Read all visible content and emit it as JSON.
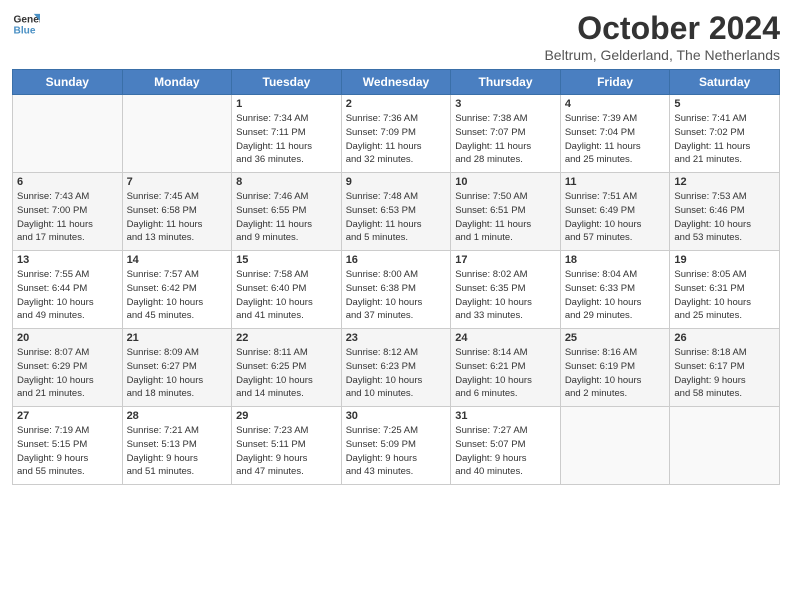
{
  "header": {
    "logo_line1": "General",
    "logo_line2": "Blue",
    "title": "October 2024",
    "location": "Beltrum, Gelderland, The Netherlands"
  },
  "days_of_week": [
    "Sunday",
    "Monday",
    "Tuesday",
    "Wednesday",
    "Thursday",
    "Friday",
    "Saturday"
  ],
  "weeks": [
    [
      {
        "day": "",
        "content": ""
      },
      {
        "day": "",
        "content": ""
      },
      {
        "day": "1",
        "content": "Sunrise: 7:34 AM\nSunset: 7:11 PM\nDaylight: 11 hours\nand 36 minutes."
      },
      {
        "day": "2",
        "content": "Sunrise: 7:36 AM\nSunset: 7:09 PM\nDaylight: 11 hours\nand 32 minutes."
      },
      {
        "day": "3",
        "content": "Sunrise: 7:38 AM\nSunset: 7:07 PM\nDaylight: 11 hours\nand 28 minutes."
      },
      {
        "day": "4",
        "content": "Sunrise: 7:39 AM\nSunset: 7:04 PM\nDaylight: 11 hours\nand 25 minutes."
      },
      {
        "day": "5",
        "content": "Sunrise: 7:41 AM\nSunset: 7:02 PM\nDaylight: 11 hours\nand 21 minutes."
      }
    ],
    [
      {
        "day": "6",
        "content": "Sunrise: 7:43 AM\nSunset: 7:00 PM\nDaylight: 11 hours\nand 17 minutes."
      },
      {
        "day": "7",
        "content": "Sunrise: 7:45 AM\nSunset: 6:58 PM\nDaylight: 11 hours\nand 13 minutes."
      },
      {
        "day": "8",
        "content": "Sunrise: 7:46 AM\nSunset: 6:55 PM\nDaylight: 11 hours\nand 9 minutes."
      },
      {
        "day": "9",
        "content": "Sunrise: 7:48 AM\nSunset: 6:53 PM\nDaylight: 11 hours\nand 5 minutes."
      },
      {
        "day": "10",
        "content": "Sunrise: 7:50 AM\nSunset: 6:51 PM\nDaylight: 11 hours\nand 1 minute."
      },
      {
        "day": "11",
        "content": "Sunrise: 7:51 AM\nSunset: 6:49 PM\nDaylight: 10 hours\nand 57 minutes."
      },
      {
        "day": "12",
        "content": "Sunrise: 7:53 AM\nSunset: 6:46 PM\nDaylight: 10 hours\nand 53 minutes."
      }
    ],
    [
      {
        "day": "13",
        "content": "Sunrise: 7:55 AM\nSunset: 6:44 PM\nDaylight: 10 hours\nand 49 minutes."
      },
      {
        "day": "14",
        "content": "Sunrise: 7:57 AM\nSunset: 6:42 PM\nDaylight: 10 hours\nand 45 minutes."
      },
      {
        "day": "15",
        "content": "Sunrise: 7:58 AM\nSunset: 6:40 PM\nDaylight: 10 hours\nand 41 minutes."
      },
      {
        "day": "16",
        "content": "Sunrise: 8:00 AM\nSunset: 6:38 PM\nDaylight: 10 hours\nand 37 minutes."
      },
      {
        "day": "17",
        "content": "Sunrise: 8:02 AM\nSunset: 6:35 PM\nDaylight: 10 hours\nand 33 minutes."
      },
      {
        "day": "18",
        "content": "Sunrise: 8:04 AM\nSunset: 6:33 PM\nDaylight: 10 hours\nand 29 minutes."
      },
      {
        "day": "19",
        "content": "Sunrise: 8:05 AM\nSunset: 6:31 PM\nDaylight: 10 hours\nand 25 minutes."
      }
    ],
    [
      {
        "day": "20",
        "content": "Sunrise: 8:07 AM\nSunset: 6:29 PM\nDaylight: 10 hours\nand 21 minutes."
      },
      {
        "day": "21",
        "content": "Sunrise: 8:09 AM\nSunset: 6:27 PM\nDaylight: 10 hours\nand 18 minutes."
      },
      {
        "day": "22",
        "content": "Sunrise: 8:11 AM\nSunset: 6:25 PM\nDaylight: 10 hours\nand 14 minutes."
      },
      {
        "day": "23",
        "content": "Sunrise: 8:12 AM\nSunset: 6:23 PM\nDaylight: 10 hours\nand 10 minutes."
      },
      {
        "day": "24",
        "content": "Sunrise: 8:14 AM\nSunset: 6:21 PM\nDaylight: 10 hours\nand 6 minutes."
      },
      {
        "day": "25",
        "content": "Sunrise: 8:16 AM\nSunset: 6:19 PM\nDaylight: 10 hours\nand 2 minutes."
      },
      {
        "day": "26",
        "content": "Sunrise: 8:18 AM\nSunset: 6:17 PM\nDaylight: 9 hours\nand 58 minutes."
      }
    ],
    [
      {
        "day": "27",
        "content": "Sunrise: 7:19 AM\nSunset: 5:15 PM\nDaylight: 9 hours\nand 55 minutes."
      },
      {
        "day": "28",
        "content": "Sunrise: 7:21 AM\nSunset: 5:13 PM\nDaylight: 9 hours\nand 51 minutes."
      },
      {
        "day": "29",
        "content": "Sunrise: 7:23 AM\nSunset: 5:11 PM\nDaylight: 9 hours\nand 47 minutes."
      },
      {
        "day": "30",
        "content": "Sunrise: 7:25 AM\nSunset: 5:09 PM\nDaylight: 9 hours\nand 43 minutes."
      },
      {
        "day": "31",
        "content": "Sunrise: 7:27 AM\nSunset: 5:07 PM\nDaylight: 9 hours\nand 40 minutes."
      },
      {
        "day": "",
        "content": ""
      },
      {
        "day": "",
        "content": ""
      }
    ]
  ]
}
